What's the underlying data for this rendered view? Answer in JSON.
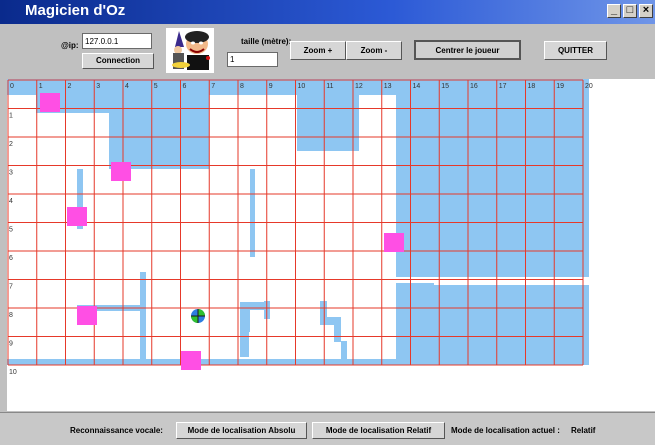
{
  "window": {
    "title": "Magicien d'Oz"
  },
  "toolbar": {
    "ip_label": "@ip:",
    "ip_value": "127.0.0.1",
    "connection_label": "Connection",
    "size_label": "taille (mètre):",
    "size_value": "1",
    "zoom_in_label": "Zoom +",
    "zoom_out_label": "Zoom -",
    "center_label": "Centrer le joueur",
    "quit_label": "QUITTER"
  },
  "map": {
    "col_labels": [
      "0",
      "1",
      "2",
      "3",
      "4",
      "5",
      "6",
      "7",
      "8",
      "9",
      "10",
      "11",
      "12",
      "13",
      "14",
      "15",
      "16",
      "17",
      "18",
      "19",
      "20"
    ],
    "row_labels": [
      "0",
      "1",
      "2",
      "3",
      "4",
      "5",
      "6",
      "7",
      "8",
      "9",
      "10"
    ],
    "colors": {
      "wall": "#8ec6f2",
      "grid": "#e6392a",
      "marker": "#ff4fe4",
      "floor": "#ffffff"
    }
  },
  "statusbar": {
    "voice_label": "Reconnaissance vocale:",
    "absolute_mode_label": "Mode de localisation Absolu",
    "relative_mode_label": "Mode de localisation Relatif",
    "current_mode_label": "Mode de localisation actuel :",
    "current_mode_value": "Relatif"
  }
}
